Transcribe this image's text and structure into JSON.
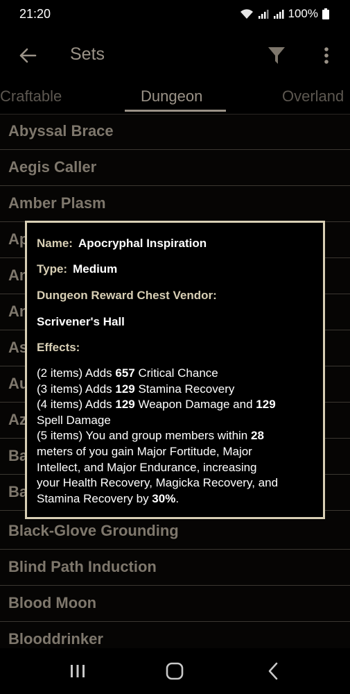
{
  "status": {
    "time": "21:20",
    "battery": "100%"
  },
  "app_bar": {
    "title": "Sets",
    "back_icon": "arrow-left-icon",
    "filter_icon": "filter-icon",
    "more_icon": "more-vert-icon"
  },
  "tabs": [
    {
      "label": "Craftable",
      "active": false
    },
    {
      "label": "Dungeon",
      "active": true
    },
    {
      "label": "Overland",
      "active": false
    }
  ],
  "list": {
    "items": [
      "Abyssal Brace",
      "Aegis Caller",
      "Amber Plasm",
      "Ap",
      "An",
      "An",
      "As",
      "Au",
      "Az",
      "Ba",
      "Ba",
      "Black-Glove Grounding",
      "Blind Path Induction",
      "Blood Moon",
      "Blooddrinker"
    ]
  },
  "popup": {
    "name_label": "Name:",
    "name_value": "Apocryphal Inspiration",
    "type_label": "Type:",
    "type_value": "Medium",
    "vendor_label": "Dungeon Reward Chest Vendor:",
    "vendor_value": "Scrivener's Hall",
    "effects_label": "Effects:",
    "effects": {
      "e1": {
        "a": "(2 items) Adds ",
        "b": "657",
        "c": " Critical Chance"
      },
      "e2": {
        "a": "(3 items) Adds ",
        "b": "129",
        "c": " Stamina Recovery"
      },
      "e3": {
        "a": "(4 items) Adds ",
        "b": "129",
        "c": " Weapon Damage and ",
        "d": "129",
        "e": "Spell Damage"
      },
      "e4": {
        "a": "(5 items) You and group members within ",
        "b": "28",
        "c": "meters of you gain Major Fortitude, Major",
        "d": "Intellect, and Major Endurance, increasing",
        "e": "your Health Recovery, Magicka Recovery, and",
        "f": "Stamina Recovery by ",
        "g": "30%",
        "h": "."
      }
    }
  },
  "nav": {
    "recents_icon": "recents-icon",
    "home_icon": "home-icon",
    "back_icon": "back-chevron-icon"
  }
}
